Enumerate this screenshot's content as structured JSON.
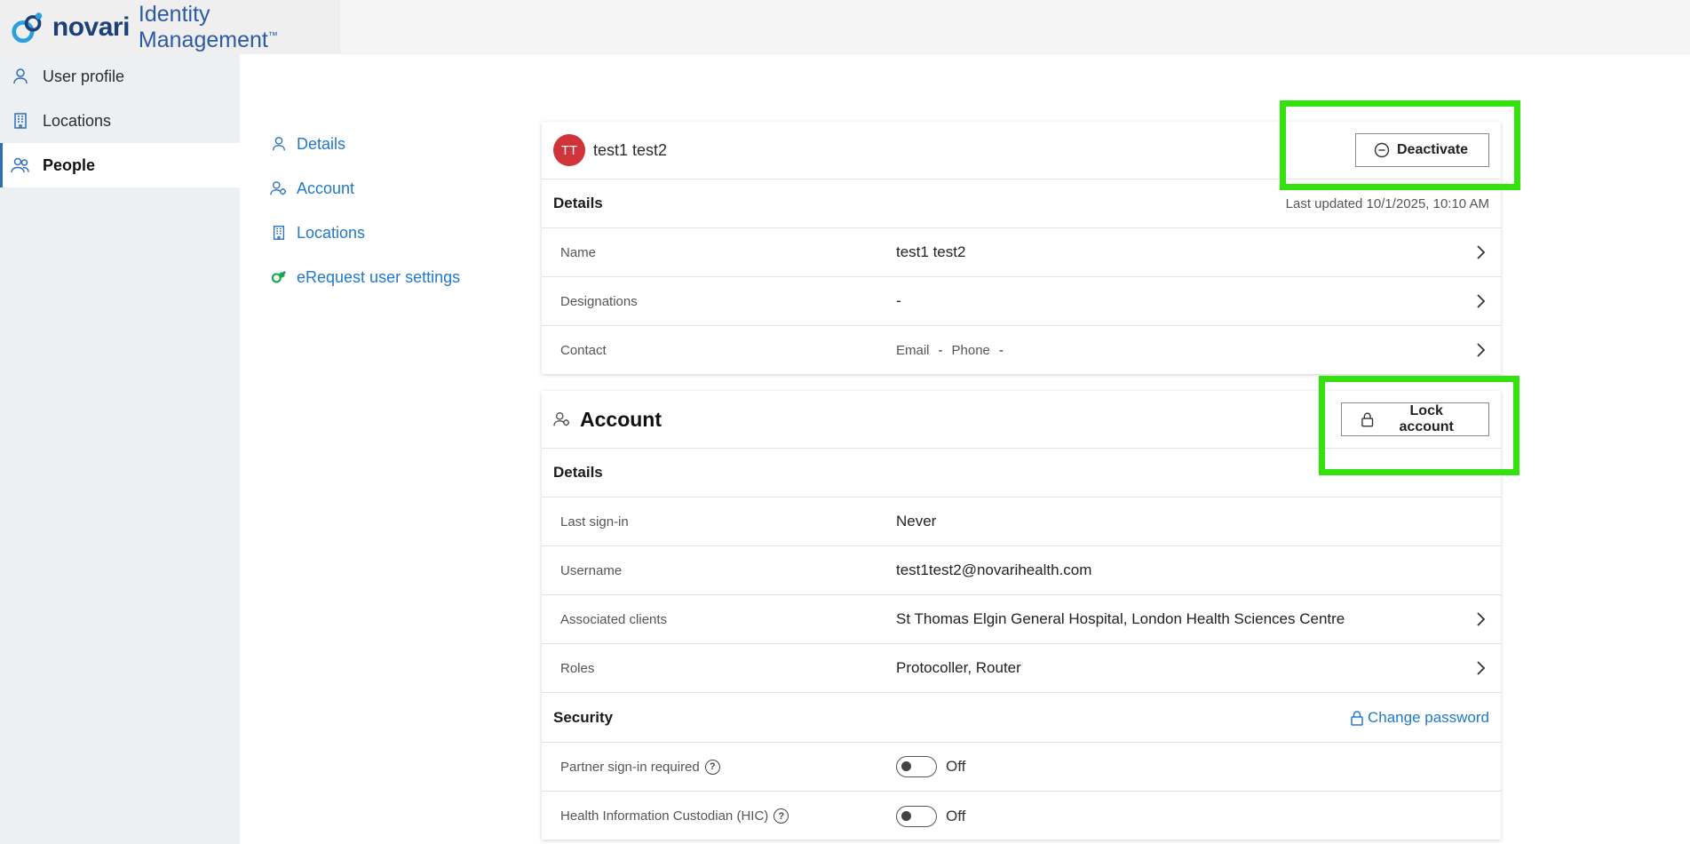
{
  "brand": {
    "name": "novari",
    "product": "Identity Management",
    "tm": "™"
  },
  "sidebar": {
    "items": [
      {
        "label": "User profile",
        "icon": "person-icon"
      },
      {
        "label": "Locations",
        "icon": "building-icon"
      },
      {
        "label": "People",
        "icon": "people-icon",
        "active": true
      }
    ]
  },
  "subnav": {
    "items": [
      {
        "label": "Details",
        "icon": "person-icon"
      },
      {
        "label": "Account",
        "icon": "account-icon"
      },
      {
        "label": "Locations",
        "icon": "building-icon"
      },
      {
        "label": "eRequest user settings",
        "icon": "erequest-icon"
      }
    ]
  },
  "person": {
    "initials": "TT",
    "name": "test1 test2",
    "deactivate_label": "Deactivate"
  },
  "details": {
    "title": "Details",
    "last_updated": "Last updated 10/1/2025, 10:10 AM",
    "rows": [
      {
        "label": "Name",
        "value": "test1 test2"
      },
      {
        "label": "Designations",
        "value": "-"
      },
      {
        "label": "Contact",
        "email_label": "Email",
        "email_value": "-",
        "phone_label": "Phone",
        "phone_value": "-"
      }
    ]
  },
  "account": {
    "title": "Account",
    "lock_label": "Lock account",
    "details_title": "Details",
    "rows": [
      {
        "label": "Last sign-in",
        "value": "Never"
      },
      {
        "label": "Username",
        "value": "test1test2@novarihealth.com"
      },
      {
        "label": "Associated clients",
        "value": "St Thomas Elgin General Hospital, London Health Sciences Centre"
      },
      {
        "label": "Roles",
        "value": "Protocoller, Router"
      }
    ],
    "security_title": "Security",
    "change_password_label": "Change password",
    "security_rows": [
      {
        "label": "Partner sign-in required",
        "help": "?",
        "state": "Off"
      },
      {
        "label": "Health Information Custodian (HIC)",
        "help": "?",
        "state": "Off"
      }
    ]
  },
  "colors": {
    "accent": "#2179c8",
    "avatar": "#d13438",
    "highlight": "#33e10c"
  }
}
